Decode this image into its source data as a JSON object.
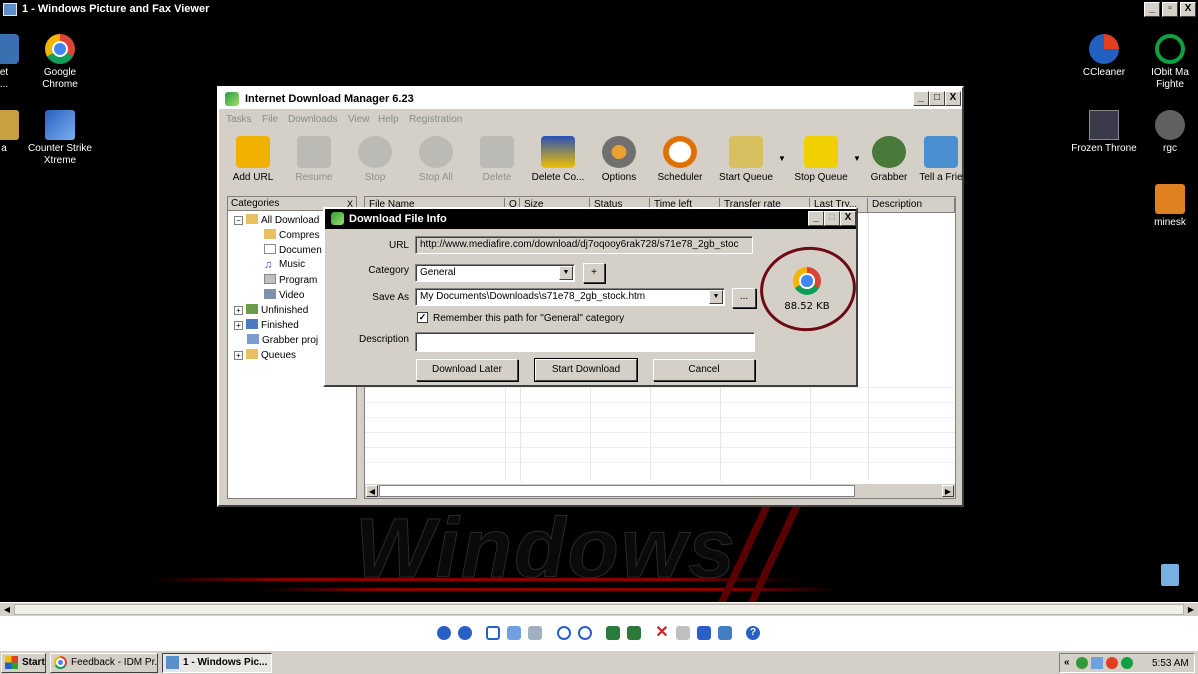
{
  "viewer": {
    "title": "1 - Windows Picture and Fax Viewer",
    "window_buttons": [
      "_",
      "▫",
      "X"
    ]
  },
  "desktop": {
    "watermark": "Windows",
    "left_icons": [
      {
        "label": "et\n...",
        "icon": "network-icon"
      },
      {
        "label": "Google\nChrome",
        "icon": "chrome-icon"
      },
      {
        "label": "a",
        "icon": "folder-icon"
      },
      {
        "label": "Counter Strike\nXtreme",
        "icon": "game-icon"
      }
    ],
    "right_icons": [
      {
        "label": "CCleaner",
        "icon": "ccleaner-icon"
      },
      {
        "label": "IObit Ma\nFighte",
        "icon": "iobit-icon"
      },
      {
        "label": "Frozen Throne",
        "icon": "warcraft-icon"
      },
      {
        "label": "rgc",
        "icon": "rgc-icon"
      },
      {
        "label": "minesk",
        "icon": "minesweeper-icon"
      },
      {
        "label": "",
        "icon": "recycle-bin-icon"
      }
    ]
  },
  "idm": {
    "title": "Internet Download Manager 6.23",
    "menu": [
      "Tasks",
      "File",
      "Downloads",
      "View",
      "Help",
      "Registration"
    ],
    "toolbar": [
      {
        "label": "Add URL",
        "enabled": true,
        "color": "#f0b000"
      },
      {
        "label": "Resume",
        "enabled": false,
        "color": "#a0a0a0"
      },
      {
        "label": "Stop",
        "enabled": false,
        "color": "#a0a0a0"
      },
      {
        "label": "Stop All",
        "enabled": false,
        "color": "#a0a0a0"
      },
      {
        "label": "Delete",
        "enabled": false,
        "color": "#a0a0a0"
      },
      {
        "label": "Delete Co...",
        "enabled": true,
        "color": "#2850b8"
      },
      {
        "label": "Options",
        "enabled": true,
        "color": "#707070"
      },
      {
        "label": "Scheduler",
        "enabled": true,
        "color": "#e07000"
      },
      {
        "label": "Start Queue",
        "enabled": true,
        "color": "#d8c060"
      },
      {
        "label": "Stop Queue",
        "enabled": true,
        "color": "#f0d000"
      },
      {
        "label": "Grabber",
        "enabled": true,
        "color": "#4a7a3a"
      },
      {
        "label": "Tell a Frie",
        "enabled": true,
        "color": "#4a90d0"
      }
    ],
    "categories_header": "Categories",
    "tree": [
      {
        "label": "All Download",
        "level": 0,
        "expander": "−",
        "icon": "folder-open-icon"
      },
      {
        "label": "Compres",
        "level": 1,
        "icon": "archive-icon"
      },
      {
        "label": "Documen",
        "level": 1,
        "icon": "document-icon"
      },
      {
        "label": "Music",
        "level": 1,
        "icon": "music-icon"
      },
      {
        "label": "Program",
        "level": 1,
        "icon": "program-icon"
      },
      {
        "label": "Video",
        "level": 1,
        "icon": "video-icon"
      },
      {
        "label": "Unfinished",
        "level": 0,
        "expander": "+",
        "icon": "unfinished-icon"
      },
      {
        "label": "Finished",
        "level": 0,
        "expander": "+",
        "icon": "finished-icon"
      },
      {
        "label": "Grabber proj",
        "level": 0,
        "expander": "",
        "icon": "grabber-icon"
      },
      {
        "label": "Queues",
        "level": 0,
        "expander": "+",
        "icon": "queues-icon"
      }
    ],
    "columns": [
      "File Name",
      "Q",
      "Size",
      "Status",
      "Time left",
      "Transfer rate",
      "Last Try...",
      "Description"
    ]
  },
  "dialog": {
    "title": "Download File Info",
    "url_label": "URL",
    "url_value": "http://www.mediafire.com/download/dj7oqooy6rak728/s71e78_2gb_stoc",
    "category_label": "Category",
    "category_value": "General",
    "add_category": "+",
    "save_as_label": "Save As",
    "save_as_value": "My Documents\\Downloads\\s71e78_2gb_stock.htm",
    "browse": "...",
    "remember_label": "Remember this path for \"General\" category",
    "remember_checked": true,
    "description_label": "Description",
    "description_value": "",
    "file_size": "88.52 KB",
    "buttons": {
      "later": "Download Later",
      "start": "Start Download",
      "cancel": "Cancel"
    },
    "annotation_color": "#6e0a14"
  },
  "taskbar": {
    "start": "Start",
    "tasks": [
      {
        "label": "Feedback - IDM Pr...",
        "active": false
      },
      {
        "label": "1 - Windows Pic...",
        "active": true
      }
    ],
    "tray_expander": "«",
    "clock": "5:53 AM"
  }
}
